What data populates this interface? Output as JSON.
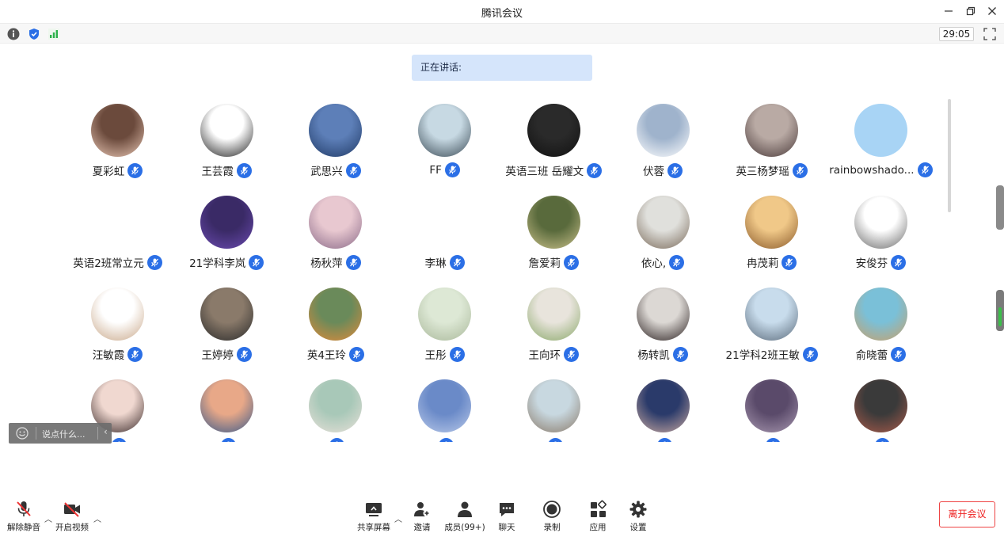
{
  "window": {
    "title": "腾讯会议"
  },
  "status": {
    "timer": "29:05"
  },
  "speaking": {
    "label": "正在讲话:"
  },
  "participants": [
    {
      "name": "夏彩虹",
      "c1": "#6b4a3c",
      "c2": "#e8c6b4"
    },
    {
      "name": "王芸霞",
      "c1": "#ffffff",
      "c2": "#222222"
    },
    {
      "name": "武思兴",
      "c1": "#5d7fb8",
      "c2": "#203a66"
    },
    {
      "name": "FF",
      "c1": "#c7d9e3",
      "c2": "#3a4a55"
    },
    {
      "name": "英语三班 岳耀文",
      "c1": "#2a2a2a",
      "c2": "#111111"
    },
    {
      "name": "伏蓉",
      "c1": "#9fb3cc",
      "c2": "#ffffff"
    },
    {
      "name": "英三杨梦瑶",
      "c1": "#b9aaa4",
      "c2": "#4a3a3a"
    },
    {
      "name": "rainbowshado...",
      "c1": "#a8d4f5",
      "c2": "#a8d4f5"
    },
    {
      "name": "英语2班常立元",
      "c1": "#ffffff",
      "c2": "#ffffff"
    },
    {
      "name": "21学科李岚",
      "c1": "#3a2a66",
      "c2": "#6a4ab0"
    },
    {
      "name": "杨秋萍",
      "c1": "#e8c8d0",
      "c2": "#8a6a88"
    },
    {
      "name": "李琳",
      "c1": "#ffffff",
      "c2": "#ffffff"
    },
    {
      "name": "詹爱莉",
      "c1": "#596a3c",
      "c2": "#c9c08a"
    },
    {
      "name": "依心,",
      "c1": "#e0e0dc",
      "c2": "#7a6a5a"
    },
    {
      "name": "冉茂莉",
      "c1": "#f0c888",
      "c2": "#8a5a2a"
    },
    {
      "name": "安俊芬",
      "c1": "#ffffff",
      "c2": "#6a6a6a"
    },
    {
      "name": "汪敏霞",
      "c1": "#ffffff",
      "c2": "#c9a88a"
    },
    {
      "name": "王婷婷",
      "c1": "#8a7a6a",
      "c2": "#2a2a2a"
    },
    {
      "name": "英4王玲",
      "c1": "#6a8a5a",
      "c2": "#e08a3a"
    },
    {
      "name": "王彤",
      "c1": "#dde8d5",
      "c2": "#a9b89a"
    },
    {
      "name": "王向环",
      "c1": "#e8e4dc",
      "c2": "#8aa86a"
    },
    {
      "name": "杨转凯",
      "c1": "#dcd8d4",
      "c2": "#2a2020"
    },
    {
      "name": "21学科2班王敏",
      "c1": "#c8dcec",
      "c2": "#5a6a7a"
    },
    {
      "name": "俞晓蕾",
      "c1": "#7ac0d8",
      "c2": "#c9a06a"
    },
    {
      "name": "",
      "c1": "#f0d8d0",
      "c2": "#3a2a2a"
    },
    {
      "name": "",
      "c1": "#e8a888",
      "c2": "#3a5a8a"
    },
    {
      "name": "",
      "c1": "#a8c8b8",
      "c2": "#e8e0d8"
    },
    {
      "name": "",
      "c1": "#6a8ac8",
      "c2": "#b8c8e8"
    },
    {
      "name": "",
      "c1": "#c8d8e0",
      "c2": "#8a7a6a"
    },
    {
      "name": "",
      "c1": "#2a3a6a",
      "c2": "#c8a8a0"
    },
    {
      "name": "",
      "c1": "#5a4a6a",
      "c2": "#a898b0"
    },
    {
      "name": "",
      "c1": "#3a3a3a",
      "c2": "#a85a4a"
    }
  ],
  "chat": {
    "placeholder": "说点什么..."
  },
  "toolbar": {
    "mute_label": "解除静音",
    "video_label": "开启视频",
    "share_label": "共享屏幕",
    "invite_label": "邀请",
    "members_label": "成员(99+)",
    "chat_label": "聊天",
    "record_label": "录制",
    "apps_label": "应用",
    "settings_label": "设置",
    "leave_label": "离开会议"
  },
  "colors": {
    "accent": "#2b6fe6",
    "speaking_bg": "#d5e5fb",
    "leave": "#e22222"
  }
}
